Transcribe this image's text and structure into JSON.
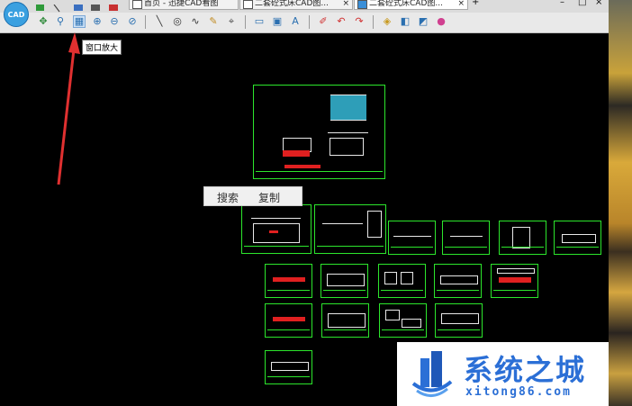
{
  "tooltip": "窗口放大",
  "tabs": [
    {
      "label": "首页 - 迅捷CAD看图",
      "close": ""
    },
    {
      "label": "二套砼式床CAD图...",
      "close": "×"
    },
    {
      "label": "二套砼式床CAD图...",
      "close": "×"
    }
  ],
  "new_tab": "+",
  "window_controls": {
    "minimize": "–",
    "maximize": "□",
    "close": "×"
  },
  "context_menu": {
    "search": "搜索",
    "copy": "复制"
  },
  "watermark": {
    "name": "系统之城",
    "url": "xitong86.com"
  },
  "app_logo": "CAD",
  "colors": {
    "drawing_border": "#2ce62c",
    "canvas": "#000000",
    "watermark_blue": "#2b6fd6",
    "arrow": "#e03030"
  },
  "toolbar_icons": [
    "pan-icon",
    "zoom-realtime-icon",
    "window-zoom-icon",
    "zoom-in-icon",
    "zoom-out-icon",
    "zoom-previous-icon",
    "line-icon",
    "circle-icon",
    "spline-icon",
    "pencil-icon",
    "measure-icon",
    "rectangle-icon",
    "frame-icon",
    "text-icon",
    "eraser-icon",
    "undo-icon",
    "redo-icon",
    "layer-icon",
    "layout-icon",
    "3d-view-icon",
    "color-icon"
  ]
}
